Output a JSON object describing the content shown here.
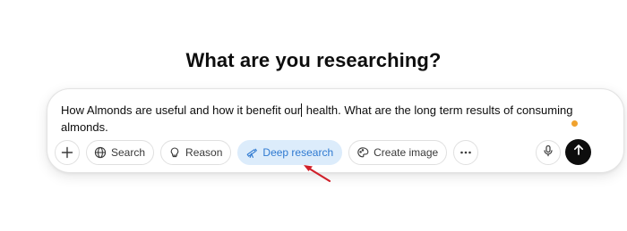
{
  "heading": "What are you researching?",
  "prompt": {
    "text_before_caret": "How Almonds are useful and how it benefit our",
    "text_after_caret": " health. What are the long term results of consuming almonds."
  },
  "toolbar": {
    "add_icon": "plus-icon",
    "search_label": "Search",
    "search_icon": "globe-icon",
    "reason_label": "Reason",
    "reason_icon": "lightbulb-icon",
    "deep_research_label": "Deep research",
    "deep_research_icon": "telescope-icon",
    "deep_research_active": true,
    "create_image_label": "Create image",
    "create_image_icon": "palette-icon",
    "more_icon": "more-dots-icon",
    "mic_icon": "microphone-icon",
    "send_icon": "arrow-up-icon"
  },
  "colors": {
    "active_pill_bg": "#dcecfb",
    "active_pill_text": "#2f7ad1",
    "status_dot": "#f0a22e",
    "annotation_arrow": "#d0202a",
    "send_button": "#0d0d0d"
  }
}
